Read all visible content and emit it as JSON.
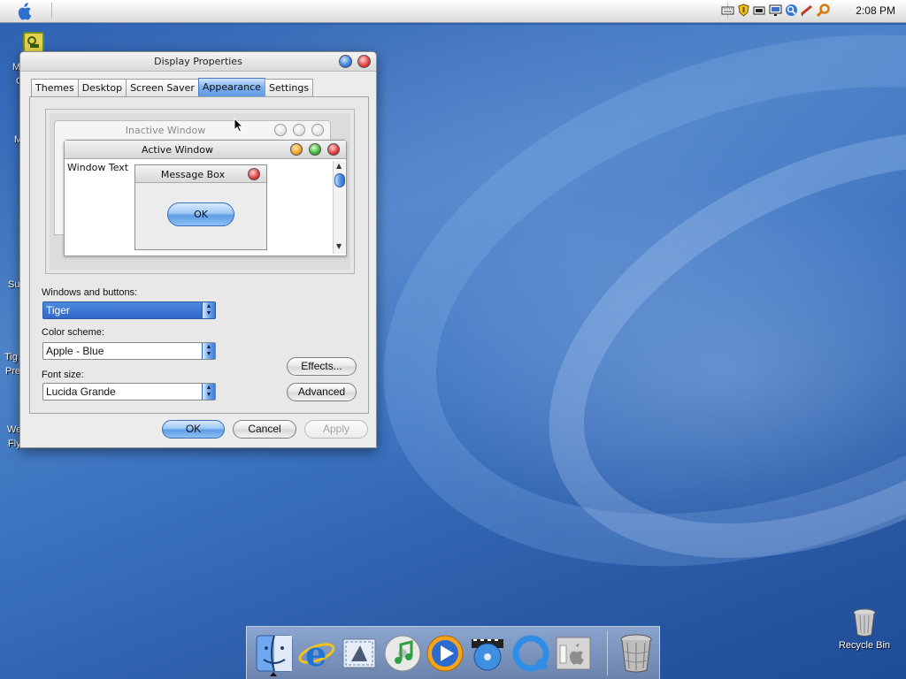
{
  "menubar": {
    "clock": "2:08 PM",
    "tray_icons": [
      "keyboard-icon",
      "shield-icon",
      "battery-icon",
      "network-icon",
      "search-icon",
      "magnifier-icon"
    ]
  },
  "desktop": {
    "left_labels": [
      "M",
      "C",
      "M",
      "Su",
      "Tig",
      "Pre",
      "We",
      "Fly"
    ],
    "recycle_bin_label": "Recycle Bin"
  },
  "window": {
    "title": "Display Properties",
    "tabs": [
      {
        "label": "Themes",
        "active": false
      },
      {
        "label": "Desktop",
        "active": false
      },
      {
        "label": "Screen Saver",
        "active": false
      },
      {
        "label": "Appearance",
        "active": true
      },
      {
        "label": "Settings",
        "active": false
      }
    ],
    "preview": {
      "inactive_title": "Inactive Window",
      "active_title": "Active Window",
      "window_text": "Window Text",
      "message_box_title": "Message Box",
      "message_box_ok": "OK"
    },
    "windows_and_buttons": {
      "label": "Windows and buttons:",
      "value": "Tiger"
    },
    "color_scheme": {
      "label": "Color scheme:",
      "value": "Apple - Blue"
    },
    "font_size": {
      "label": "Font size:",
      "value": "Lucida Grande"
    },
    "effects_button": "Effects...",
    "advanced_button": "Advanced",
    "ok_button": "OK",
    "cancel_button": "Cancel",
    "apply_button": "Apply"
  },
  "dock": {
    "items": [
      "finder-icon",
      "internet-explorer-icon",
      "mail-icon",
      "itunes-icon",
      "media-player-icon",
      "dvd-player-icon",
      "quicktime-icon",
      "system-preferences-icon",
      "trash-icon"
    ]
  },
  "colors": {
    "accent": "#5c9ce7",
    "desktop": "#3a6fb8"
  }
}
